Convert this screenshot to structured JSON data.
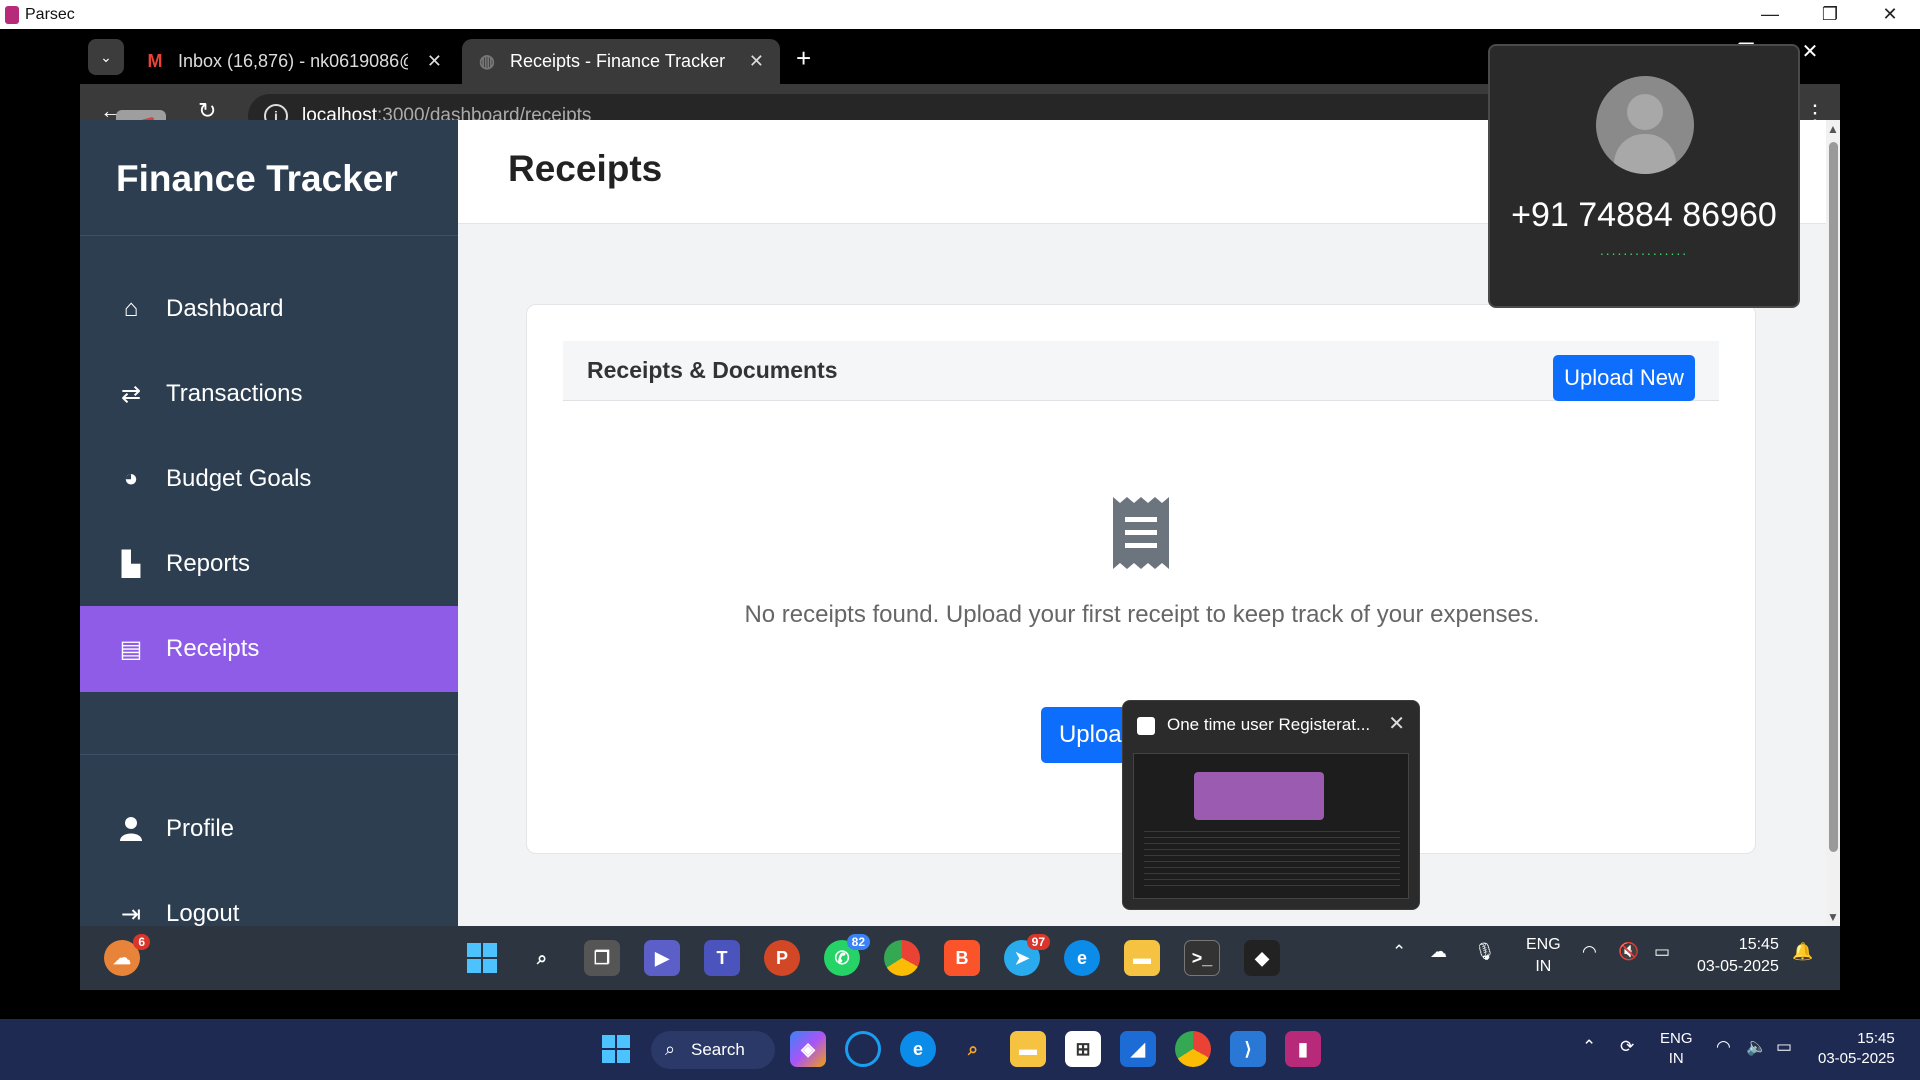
{
  "host_window": {
    "title": "Parsec",
    "controls": {
      "minimize": "—",
      "maximize": "❐",
      "close": "✕"
    }
  },
  "browser": {
    "tabs": [
      {
        "label": "Inbox (16,876) - nk0619086@g",
        "favicon": "gmail-icon",
        "close": "✕"
      },
      {
        "label": "Receipts - Finance Tracker",
        "favicon": "globe-icon",
        "close": "✕",
        "active": true
      }
    ],
    "new_tab": "+",
    "tab_list": "⌄",
    "url_host": "localhost",
    "url_path": ":3000/dashboard/receipts",
    "info_glyph": "i",
    "window_controls": {
      "minimize": "—",
      "maximize": "❐",
      "close": "✕"
    }
  },
  "app": {
    "brand": "Finance Tracker",
    "accent_color": "#8e5ce6",
    "sidebar_color": "#2c3e50",
    "nav": [
      {
        "label": "Dashboard",
        "icon": "home-icon",
        "glyph": "⌂"
      },
      {
        "label": "Transactions",
        "icon": "exchange-icon",
        "glyph": "⇄"
      },
      {
        "label": "Budget Goals",
        "icon": "pie-chart-icon",
        "glyph": "◕"
      },
      {
        "label": "Reports",
        "icon": "bar-chart-icon",
        "glyph": "▙"
      },
      {
        "label": "Receipts",
        "icon": "receipt-icon",
        "glyph": "▤",
        "active": true
      },
      {
        "label": "Profile",
        "icon": "user-icon",
        "glyph": "👤"
      },
      {
        "label": "Logout",
        "icon": "logout-icon",
        "glyph": "⇥"
      }
    ],
    "page_title": "Receipts",
    "card": {
      "title": "Receipts & Documents",
      "upload_new": "Upload New",
      "empty_text": "No receipts found. Upload your first receipt to keep track of your expenses.",
      "upload_button": "Upload Receipt"
    }
  },
  "call_popup": {
    "number": "+91 74884 86960",
    "dots": "..............."
  },
  "preview": {
    "title": "One time user Registerat...",
    "close": "✕"
  },
  "remote_taskbar": {
    "weather_badge": "6",
    "whatsapp_badge": "82",
    "telegram_badge": "97",
    "lang": "ENG",
    "region": "IN",
    "time": "15:45",
    "date": "03-05-2025"
  },
  "host_taskbar": {
    "search_label": "Search",
    "lang": "ENG",
    "region": "IN",
    "time": "15:45",
    "date": "03-05-2025"
  }
}
